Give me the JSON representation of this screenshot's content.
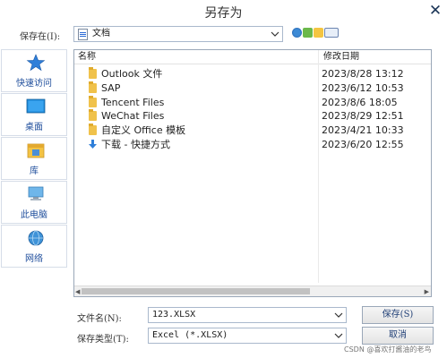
{
  "window": {
    "title": "另存为",
    "close_label": "✕"
  },
  "toolbar": {
    "save_in_label": "保存在(I):",
    "save_in_value": "文档",
    "icons": [
      "back-icon",
      "up-folder-icon",
      "new-folder-icon",
      "view-menu-icon"
    ]
  },
  "places": [
    {
      "label": "快速访问",
      "icon": "star-icon"
    },
    {
      "label": "桌面",
      "icon": "desktop-icon"
    },
    {
      "label": "库",
      "icon": "library-icon"
    },
    {
      "label": "此电脑",
      "icon": "computer-icon"
    },
    {
      "label": "网络",
      "icon": "network-icon"
    }
  ],
  "list": {
    "columns": {
      "name": "名称",
      "date": "修改日期"
    },
    "rows": [
      {
        "name": "Outlook 文件",
        "date": "2023/8/28 13:12",
        "type": "folder"
      },
      {
        "name": "SAP",
        "date": "2023/6/12 10:53",
        "type": "folder"
      },
      {
        "name": "Tencent Files",
        "date": "2023/8/6 18:05",
        "type": "folder"
      },
      {
        "name": "WeChat Files",
        "date": "2023/8/29 12:51",
        "type": "folder"
      },
      {
        "name": "自定义 Office 模板",
        "date": "2023/4/21 10:33",
        "type": "folder"
      },
      {
        "name": "下载 - 快捷方式",
        "date": "2023/6/20 12:55",
        "type": "shortcut"
      }
    ]
  },
  "filename": {
    "label": "文件名(N):",
    "value": "123.XLSX"
  },
  "filetype": {
    "label": "保存类型(T):",
    "value": "Excel (*.XLSX)"
  },
  "buttons": {
    "save": "保存(S)",
    "cancel": "取消"
  },
  "watermark": "CSDN @喜欢打酱油的老鸟"
}
